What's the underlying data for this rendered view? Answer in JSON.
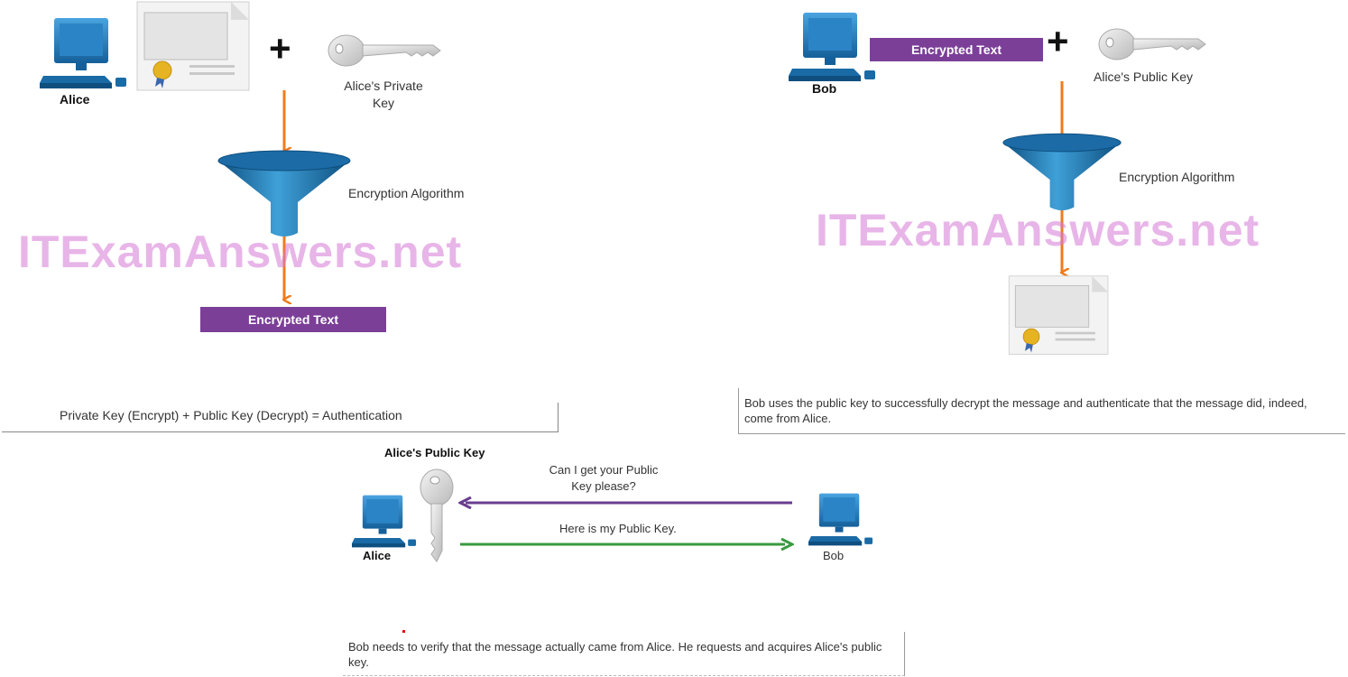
{
  "header": {
    "title_fragment": ""
  },
  "panel_left": {
    "sender_label": "Alice",
    "key_label_line1": "Alice's Private",
    "key_label_line2": "Key",
    "plus": "+",
    "algorithm_label": "Encryption Algorithm",
    "output_label": "Encrypted Text",
    "formula": "Private Key (Encrypt) + Public Key (Decrypt) = Authentication"
  },
  "panel_right": {
    "receiver_label": "Bob",
    "input_label": "Encrypted Text",
    "plus": "+",
    "key_label": "Alice's Public Key",
    "algorithm_label": "Encryption Algorithm",
    "caption": "Bob uses the public key to successfully decrypt the message and authenticate that the message did, indeed, come from Alice."
  },
  "panel_bottom": {
    "key_title": "Alice's Public Key",
    "left_label": "Alice",
    "right_label": "Bob",
    "request_text": "Can I get your Public Key please?",
    "response_text": "Here is my Public Key.",
    "caption": "Bob needs to verify that the message actually came from Alice. He requests and acquires Alice's public key."
  },
  "watermark": "ITExamAnswers.net",
  "colors": {
    "arrow_orange": "#f07b1d",
    "purple": "#7b3f98",
    "request_arrow": "#6a3d8f",
    "response_arrow": "#3a9a3f",
    "watermark": "#d678d6",
    "monitor_blue": "#1f78b4"
  }
}
